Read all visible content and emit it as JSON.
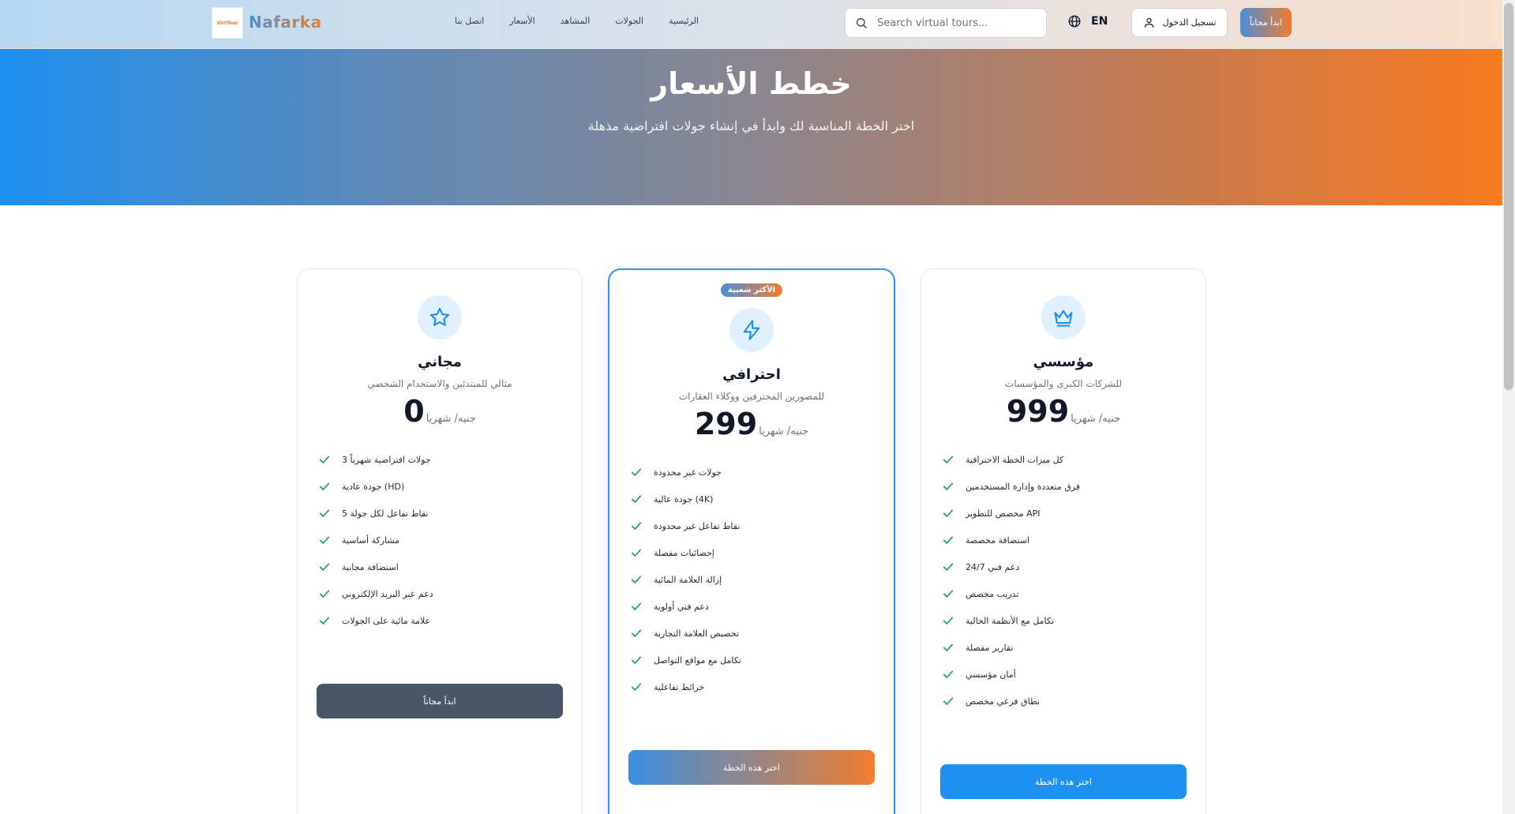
{
  "brand": {
    "logo_text": "VirtTour",
    "name": "Nafarka"
  },
  "nav": {
    "links": [
      "الرئيسية",
      "الجولات",
      "المشاهد",
      "الأسعار",
      "اتصل بنا"
    ],
    "search_placeholder": "Search virtual tours...",
    "lang": "EN",
    "login_label": "تسجيل الدخول",
    "start_label": "ابدأ مجاناً"
  },
  "hero": {
    "title": "خطط الأسعار",
    "subtitle": "اختر الخطة المناسبة لك وابدأ في إنشاء جولات افتراضية مذهلة"
  },
  "plans": [
    {
      "name": "مجاني",
      "description": "مثالي للمبتدئين والاستخدام الشخصي",
      "price": "0",
      "unit": "جنيه/ شهريا",
      "icon": "star-icon",
      "features": [
        "جولات افتراضية شهرياً 3",
        "جودة عادية (HD)",
        "نقاط تفاعل لكل جولة 5",
        "مشاركة أساسية",
        "استضافة مجانية",
        "دعم عبر البريد الإلكتروني",
        "علامة مائية على الجولات"
      ],
      "button": "ابدأ مجاناً"
    },
    {
      "badge": "الأكثر شعبية",
      "name": "احترافي",
      "description": "للمصورين المحترفين ووكلاء العقارات",
      "price": "299",
      "unit": "جنيه/ شهريا",
      "icon": "lightning-icon",
      "features": [
        "جولات غير محدودة",
        "جودة عالية (4K)",
        "نقاط تفاعل غير محدودة",
        "إحصائيات مفصلة",
        "إزالة العلامة المائية",
        "دعم فني أولوية",
        "تخصيص العلامة التجارية",
        "تكامل مع مواقع التواصل",
        "خرائط تفاعلية"
      ],
      "button": "اختر هذه الخطة"
    },
    {
      "name": "مؤسسي",
      "description": "للشركات الكبرى والمؤسسات",
      "price": "999",
      "unit": "جنيه/ شهريا",
      "icon": "crown-icon",
      "features": [
        "كل ميزات الخطة الاحترافية",
        "فرق متعددة وإدارة المستخدمين",
        "مخصص للتطوير API",
        "استضافة مخصصة",
        "دعم فني 24/7",
        "تدريب مخصص",
        "تكامل مع الأنظمة الحالية",
        "تقارير مفصلة",
        "أمان مؤسسي",
        "نطاق فرعي مخصص"
      ],
      "button": "اختر هذه الخطة"
    }
  ],
  "colors": {
    "accent_blue": "#1d90f0",
    "accent_orange": "#f97a1f",
    "check_green": "#16a34a",
    "free_button": "#4a5568"
  }
}
